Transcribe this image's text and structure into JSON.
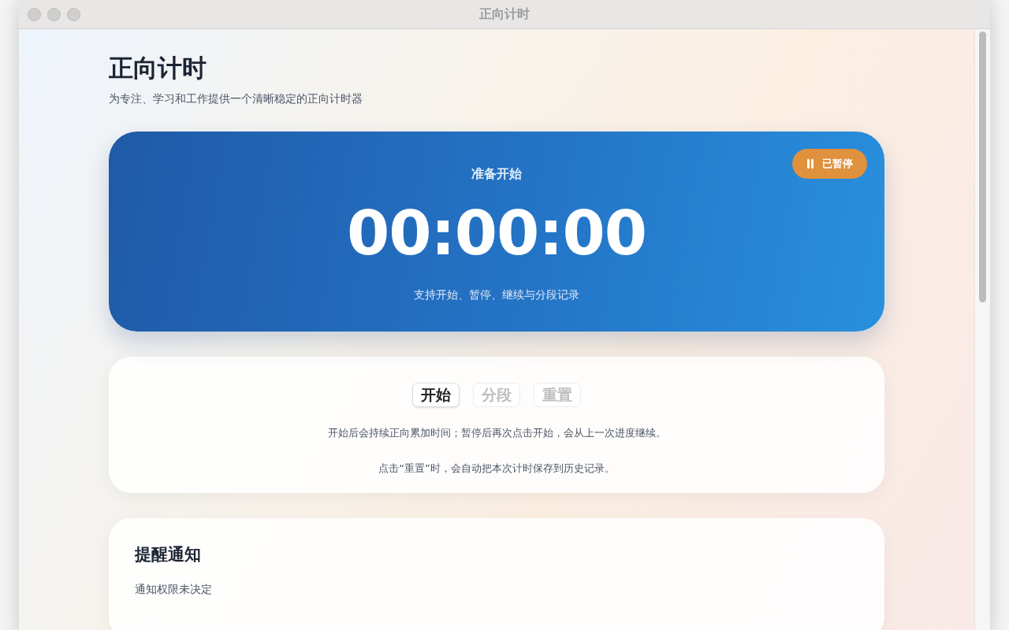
{
  "window": {
    "title": "正向计时"
  },
  "header": {
    "title": "正向计时",
    "subtitle": "为专注、学习和工作提供一个清晰稳定的正向计时器"
  },
  "timer": {
    "status_label": "准备开始",
    "time": "00:00:00",
    "hint": "支持开始、暂停、继续与分段记录",
    "badge": {
      "label": "已暂停",
      "paused": true
    }
  },
  "controls": {
    "buttons": [
      {
        "label": "开始",
        "disabled": false
      },
      {
        "label": "分段",
        "disabled": true
      },
      {
        "label": "重置",
        "disabled": true
      }
    ],
    "notes": [
      "开始后会持续正向累加时间；暂停后再次点击开始，会从上一次进度继续。",
      "点击“重置”时，会自动把本次计时保存到历史记录。"
    ]
  },
  "notifications": {
    "title": "提醒通知",
    "status": "通知权限未决定"
  }
}
